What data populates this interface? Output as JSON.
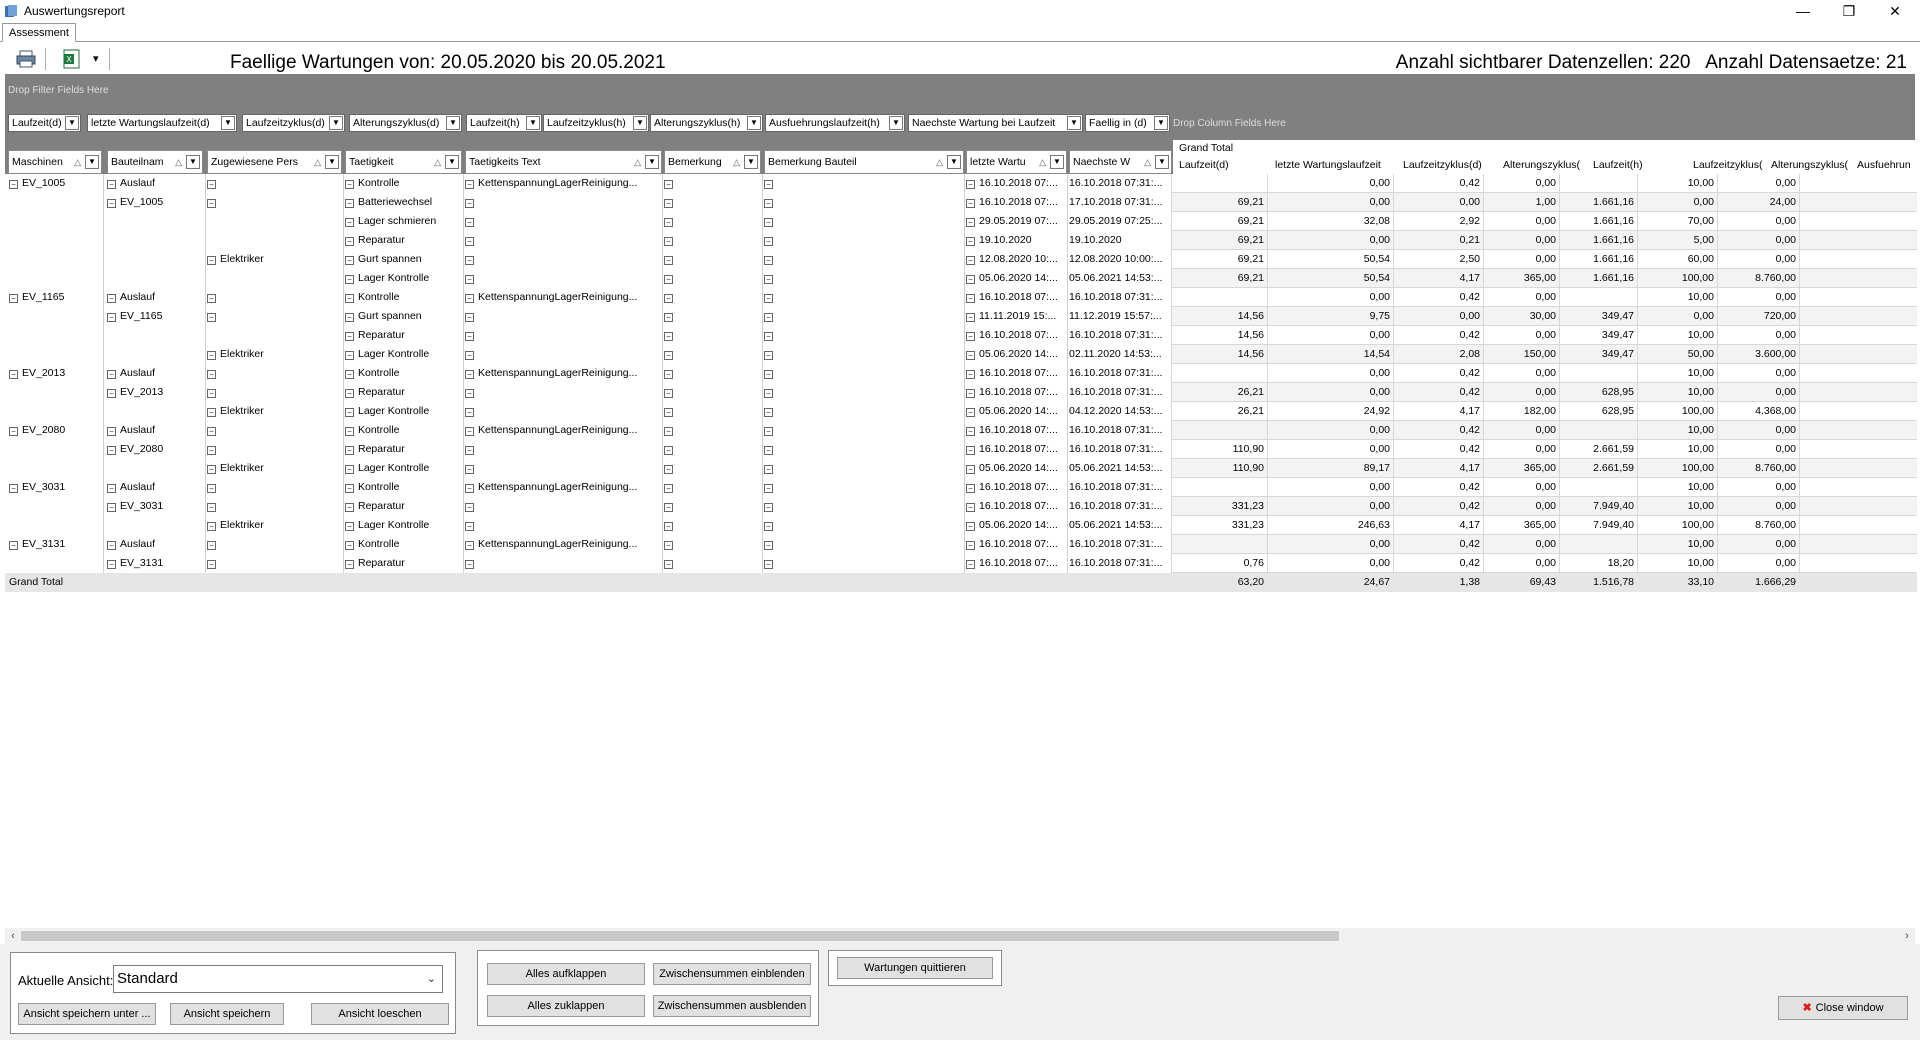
{
  "window": {
    "title": "Auswertungsreport",
    "minimize": "—",
    "restore": "❐",
    "close": "✕"
  },
  "tab": {
    "label": "Assessment"
  },
  "toolbar": {
    "report_title": "Faellige Wartungen von: 20.05.2020 bis 20.05.2021",
    "counts": "Anzahl sichtbarer Datenzellen: 220   Anzahl Datensaetze: 21",
    "print_icon": "printer-icon",
    "excel_icon": "excel-export-icon",
    "dropdown_arrow": "▾"
  },
  "filter_area": {
    "hint": "Drop Filter Fields Here"
  },
  "data_fields": [
    "Laufzeit(d)",
    "letzte Wartungslaufzeit(d)",
    "Laufzeitzyklus(d)",
    "Alterungszyklus(d)",
    "Laufzeit(h)",
    "Laufzeitzyklus(h)",
    "Alterungszyklus(h)",
    "Ausfuehrungslaufzeit(h)",
    "Naechste Wartung bei Laufzeit",
    "Faellig in (d)"
  ],
  "column_area": {
    "hint": "Drop Column Fields Here"
  },
  "row_fields": [
    "Maschinen",
    "Bauteilnam",
    "Zugewiesene Pers",
    "Taetigkeit",
    "Taetigkeits Text",
    "Bemerkung",
    "Bemerkung Bauteil",
    "letzte Wartu",
    "Naechste W"
  ],
  "grand_total_header": "Grand Total",
  "value_headers": [
    "Laufzeit(d)",
    "letzte Wartungslaufzeit",
    "Laufzeitzyklus(d)",
    "Alterungszyklus(",
    "Laufzeit(h)",
    "Laufzeitzyklus(",
    "Alterungszyklus(",
    "Ausfuehrun"
  ],
  "rows": [
    {
      "m": "EV_1005",
      "b": "Auslauf",
      "p": "",
      "t": "Kontrolle",
      "tt": "KettenspannungLagerReinigung...",
      "lw": "16.10.2018 07:...",
      "nw": "16.10.2018 07:31:...",
      "v": [
        "",
        "0,00",
        "0,42",
        "0,00",
        "",
        "10,00",
        "0,00",
        ""
      ]
    },
    {
      "m": "",
      "b": "EV_1005",
      "p": "",
      "t": "Batteriewechsel",
      "tt": "",
      "lw": "16.10.2018 07:...",
      "nw": "17.10.2018 07:31:...",
      "v": [
        "69,21",
        "0,00",
        "0,00",
        "1,00",
        "1.661,16",
        "0,00",
        "24,00",
        ""
      ]
    },
    {
      "m": "",
      "b": "",
      "p": "",
      "t": "Lager schmieren",
      "tt": "",
      "lw": "29.05.2019 07:...",
      "nw": "29.05.2019 07:25:...",
      "v": [
        "69,21",
        "32,08",
        "2,92",
        "0,00",
        "1.661,16",
        "70,00",
        "0,00",
        ""
      ]
    },
    {
      "m": "",
      "b": "",
      "p": "",
      "t": "Reparatur",
      "tt": "",
      "lw": "19.10.2020",
      "nw": "19.10.2020",
      "v": [
        "69,21",
        "0,00",
        "0,21",
        "0,00",
        "1.661,16",
        "5,00",
        "0,00",
        ""
      ]
    },
    {
      "m": "",
      "b": "",
      "p": "Elektriker",
      "t": "Gurt spannen",
      "tt": "",
      "lw": "12.08.2020 10:...",
      "nw": "12.08.2020 10:00:...",
      "v": [
        "69,21",
        "50,54",
        "2,50",
        "0,00",
        "1.661,16",
        "60,00",
        "0,00",
        ""
      ]
    },
    {
      "m": "",
      "b": "",
      "p": "",
      "t": "Lager Kontrolle",
      "tt": "",
      "lw": "05.06.2020 14:...",
      "nw": "05.06.2021 14:53:...",
      "v": [
        "69,21",
        "50,54",
        "4,17",
        "365,00",
        "1.661,16",
        "100,00",
        "8.760,00",
        ""
      ]
    },
    {
      "m": "EV_1165",
      "b": "Auslauf",
      "p": "",
      "t": "Kontrolle",
      "tt": "KettenspannungLagerReinigung...",
      "lw": "16.10.2018 07:...",
      "nw": "16.10.2018 07:31:...",
      "v": [
        "",
        "0,00",
        "0,42",
        "0,00",
        "",
        "10,00",
        "0,00",
        ""
      ]
    },
    {
      "m": "",
      "b": "EV_1165",
      "p": "",
      "t": "Gurt spannen",
      "tt": "",
      "lw": "11.11.2019 15:...",
      "nw": "11.12.2019 15:57:...",
      "v": [
        "14,56",
        "9,75",
        "0,00",
        "30,00",
        "349,47",
        "0,00",
        "720,00",
        ""
      ]
    },
    {
      "m": "",
      "b": "",
      "p": "",
      "t": "Reparatur",
      "tt": "",
      "lw": "16.10.2018 07:...",
      "nw": "16.10.2018 07:31:...",
      "v": [
        "14,56",
        "0,00",
        "0,42",
        "0,00",
        "349,47",
        "10,00",
        "0,00",
        ""
      ]
    },
    {
      "m": "",
      "b": "",
      "p": "Elektriker",
      "t": "Lager Kontrolle",
      "tt": "",
      "lw": "05.06.2020 14:...",
      "nw": "02.11.2020 14:53:...",
      "v": [
        "14,56",
        "14,54",
        "2,08",
        "150,00",
        "349,47",
        "50,00",
        "3.600,00",
        ""
      ]
    },
    {
      "m": "EV_2013",
      "b": "Auslauf",
      "p": "",
      "t": "Kontrolle",
      "tt": "KettenspannungLagerReinigung...",
      "lw": "16.10.2018 07:...",
      "nw": "16.10.2018 07:31:...",
      "v": [
        "",
        "0,00",
        "0,42",
        "0,00",
        "",
        "10,00",
        "0,00",
        ""
      ]
    },
    {
      "m": "",
      "b": "EV_2013",
      "p": "",
      "t": "Reparatur",
      "tt": "",
      "lw": "16.10.2018 07:...",
      "nw": "16.10.2018 07:31:...",
      "v": [
        "26,21",
        "0,00",
        "0,42",
        "0,00",
        "628,95",
        "10,00",
        "0,00",
        ""
      ]
    },
    {
      "m": "",
      "b": "",
      "p": "Elektriker",
      "t": "Lager Kontrolle",
      "tt": "",
      "lw": "05.06.2020 14:...",
      "nw": "04.12.2020 14:53:...",
      "v": [
        "26,21",
        "24,92",
        "4,17",
        "182,00",
        "628,95",
        "100,00",
        "4.368,00",
        ""
      ]
    },
    {
      "m": "EV_2080",
      "b": "Auslauf",
      "p": "",
      "t": "Kontrolle",
      "tt": "KettenspannungLagerReinigung...",
      "lw": "16.10.2018 07:...",
      "nw": "16.10.2018 07:31:...",
      "v": [
        "",
        "0,00",
        "0,42",
        "0,00",
        "",
        "10,00",
        "0,00",
        ""
      ]
    },
    {
      "m": "",
      "b": "EV_2080",
      "p": "",
      "t": "Reparatur",
      "tt": "",
      "lw": "16.10.2018 07:...",
      "nw": "16.10.2018 07:31:...",
      "v": [
        "110,90",
        "0,00",
        "0,42",
        "0,00",
        "2.661,59",
        "10,00",
        "0,00",
        ""
      ]
    },
    {
      "m": "",
      "b": "",
      "p": "Elektriker",
      "t": "Lager Kontrolle",
      "tt": "",
      "lw": "05.06.2020 14:...",
      "nw": "05.06.2021 14:53:...",
      "v": [
        "110,90",
        "89,17",
        "4,17",
        "365,00",
        "2.661,59",
        "100,00",
        "8.760,00",
        ""
      ]
    },
    {
      "m": "EV_3031",
      "b": "Auslauf",
      "p": "",
      "t": "Kontrolle",
      "tt": "KettenspannungLagerReinigung...",
      "lw": "16.10.2018 07:...",
      "nw": "16.10.2018 07:31:...",
      "v": [
        "",
        "0,00",
        "0,42",
        "0,00",
        "",
        "10,00",
        "0,00",
        ""
      ]
    },
    {
      "m": "",
      "b": "EV_3031",
      "p": "",
      "t": "Reparatur",
      "tt": "",
      "lw": "16.10.2018 07:...",
      "nw": "16.10.2018 07:31:...",
      "v": [
        "331,23",
        "0,00",
        "0,42",
        "0,00",
        "7.949,40",
        "10,00",
        "0,00",
        ""
      ]
    },
    {
      "m": "",
      "b": "",
      "p": "Elektriker",
      "t": "Lager Kontrolle",
      "tt": "",
      "lw": "05.06.2020 14:...",
      "nw": "05.06.2021 14:53:...",
      "v": [
        "331,23",
        "246,63",
        "4,17",
        "365,00",
        "7.949,40",
        "100,00",
        "8.760,00",
        ""
      ]
    },
    {
      "m": "EV_3131",
      "b": "Auslauf",
      "p": "",
      "t": "Kontrolle",
      "tt": "KettenspannungLagerReinigung...",
      "lw": "16.10.2018 07:...",
      "nw": "16.10.2018 07:31:...",
      "v": [
        "",
        "0,00",
        "0,42",
        "0,00",
        "",
        "10,00",
        "0,00",
        ""
      ]
    },
    {
      "m": "",
      "b": "EV_3131",
      "p": "",
      "t": "Reparatur",
      "tt": "",
      "lw": "16.10.2018 07:...",
      "nw": "16.10.2018 07:31:...",
      "v": [
        "0,76",
        "0,00",
        "0,42",
        "0,00",
        "18,20",
        "10,00",
        "0,00",
        ""
      ]
    }
  ],
  "grand_total": {
    "label": "Grand Total",
    "v": [
      "63,20",
      "24,67",
      "1,38",
      "69,43",
      "1.516,78",
      "33,10",
      "1.666,29",
      ""
    ]
  },
  "bottom": {
    "view_label": "Aktuelle Ansicht:",
    "view_value": "Standard",
    "save_as": "Ansicht speichern unter ...",
    "save": "Ansicht speichern",
    "delete": "Ansicht loeschen",
    "expand_all": "Alles aufklappen",
    "collapse_all": "Alles zuklappen",
    "show_subtotals": "Zwischensummen einblenden",
    "hide_subtotals": "Zwischensummen ausblenden",
    "acknowledge": "Wartungen quittieren",
    "close": "Close window"
  },
  "colors": {
    "header_gray": "#808080",
    "grand_total_bg": "#e6e6e6",
    "close_icon": "#e02020"
  }
}
